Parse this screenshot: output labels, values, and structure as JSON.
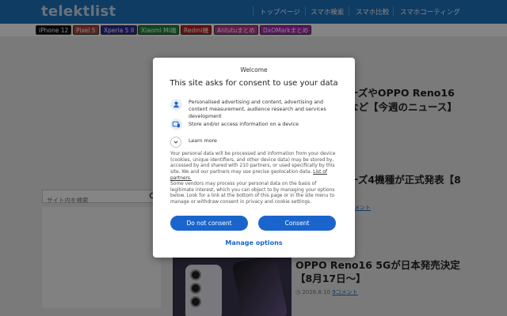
{
  "header": {
    "logo": "telektlist",
    "nav": [
      "トップページ",
      "スマホ検索",
      "スマホ比較",
      "スマホコーティング"
    ]
  },
  "tags": [
    {
      "label": "iPhone 12",
      "color": "#111111"
    },
    {
      "label": "Pixel 5",
      "color": "#b5473c"
    },
    {
      "label": "Xperia 5 II",
      "color": "#2f2aa0"
    },
    {
      "label": "Xiaomi Mi端",
      "color": "#1e8f3a"
    },
    {
      "label": "Redmi機",
      "color": "#c42121"
    },
    {
      "label": "Antutuまとめ",
      "color": "#c43a97"
    },
    {
      "label": "DxOMarkまとめ",
      "color": "#b42ab8"
    }
  ],
  "articles": [
    {
      "title_line1": "ーズやOPPO Reno16",
      "title_line2": "など【今週のニュース】",
      "meta": ""
    },
    {
      "title_line1": "ーズ4機種が正式発表【8",
      "title_line2": "",
      "meta": "",
      "comments": "コメント"
    },
    {
      "title_line1": "OPPO Reno16 5Gが日本発売決定",
      "title_line2": "【8月17日〜】",
      "meta": "2026.8.10",
      "comments": "9コメント"
    }
  ],
  "search": {
    "placeholder": "サイト内を検索"
  },
  "consent": {
    "welcome": "Welcome",
    "title": "This site asks for consent to use your data",
    "purposes": [
      {
        "icon": "person-icon",
        "text": "Personalised advertising and content, advertising and content measurement, audience research and services development"
      },
      {
        "icon": "device-icon",
        "text": "Store and/or access information on a device"
      }
    ],
    "learn_more": "Learn more",
    "paragraph1": "Your personal data will be processed and information from your device (cookies, unique identifiers, and other device data) may be stored by, accessed by and shared with 210 partners, or used specifically by this site. We and our partners may use precise geolocation data.",
    "partners_link": "List of partners.",
    "paragraph2": "Some vendors may process your personal data on the basis of legitimate interest, which you can object to by managing your options below. Look for a link at the bottom of this page or in the site menu to manage or withdraw consent in privacy and cookie settings.",
    "do_not_consent": "Do not consent",
    "consent": "Consent",
    "manage_options": "Manage options"
  },
  "colors": {
    "brand": "#1e73be",
    "button": "#1a65cc"
  }
}
